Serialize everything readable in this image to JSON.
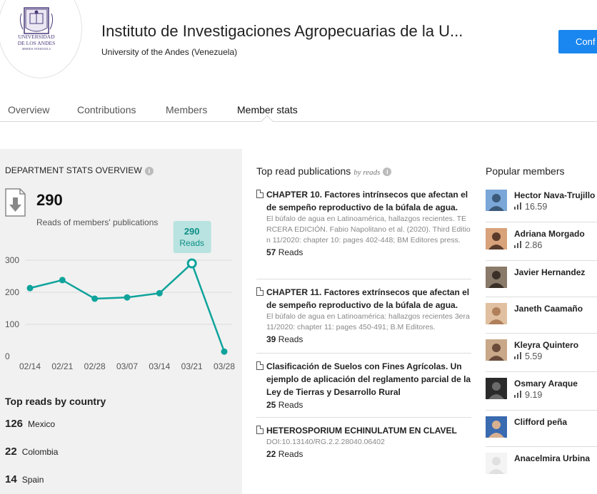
{
  "header": {
    "title": "Instituto de Investigaciones Agropecuarias de la U...",
    "subtitle": "University of the Andes (Venezuela)",
    "follow_label": "Conf",
    "logo_text_line1": "UNIVERSIDAD",
    "logo_text_line2": "DE LOS ANDES",
    "logo_text_line3": "MERIDA VENEZUELA"
  },
  "tabs": [
    "Overview",
    "Contributions",
    "Members",
    "Member stats"
  ],
  "stats": {
    "heading": "DEPARTMENT STATS OVERVIEW",
    "total": "290",
    "total_label": "Reads of members' publications",
    "tooltip_value": "290",
    "tooltip_label": "Reads"
  },
  "chart_data": {
    "type": "line",
    "x": [
      "02/14",
      "02/21",
      "02/28",
      "03/07",
      "03/14",
      "03/21",
      "03/28"
    ],
    "series": [
      {
        "values": [
          213,
          238,
          180,
          184,
          197,
          290,
          15
        ]
      }
    ],
    "yticks": [
      0,
      100,
      200,
      300
    ],
    "ylim": [
      0,
      300
    ],
    "color": "#0fa39b",
    "grid": true,
    "highlight_index": 5
  },
  "countries": {
    "heading": "Top reads by country",
    "items": [
      {
        "count": "126",
        "name": "Mexico"
      },
      {
        "count": "22",
        "name": "Colombia"
      },
      {
        "count": "14",
        "name": "Spain"
      }
    ]
  },
  "publications": {
    "heading": "Top read publications",
    "heading_sub": "by reads",
    "items": [
      {
        "title": "CHAPTER 10. Factores intrínsecos que afectan el de sempeño reproductivo de la búfala de agua.",
        "meta": "El búfalo de agua en Latinoamérica, hallazgos recientes. TERCERA EDICIÓN. Fabio Napolitano et al. (2020). Third Edition 11/2020: chapter 10: pages 402-448; BM Editores press.",
        "reads": "57",
        "reads_label": "Reads"
      },
      {
        "title": "CHAPTER 11. Factores extrínsecos que afectan el de sempeño reproductivo de la búfala de agua.",
        "meta": "El búfalo de agua en Latinoamérica: hallazgos recientes 3era 11/2020: chapter 11: pages 450-491; B.M Editores.",
        "reads": "39",
        "reads_label": "Reads"
      },
      {
        "title": "Clasificación de Suelos con Fines Agrícolas. Un ejemplo de aplicación del reglamento parcial de la Ley de Tierras y Desarrollo Rural",
        "meta": "",
        "reads": "25",
        "reads_label": "Reads"
      },
      {
        "title": "HETEROSPORIUM ECHINULATUM EN CLAVEL",
        "meta": "DOI:10.13140/RG.2.2.28040.06402",
        "reads": "22",
        "reads_label": "Reads"
      }
    ]
  },
  "members": {
    "heading": "Popular members",
    "items": [
      {
        "name": "Hector Nava-Trujillo",
        "score": "16.59"
      },
      {
        "name": "Adriana Morgado",
        "score": "2.86"
      },
      {
        "name": "Javier Hernandez",
        "score": ""
      },
      {
        "name": "Janeth Caamaño",
        "score": ""
      },
      {
        "name": "Kleyra Quintero",
        "score": "5.59"
      },
      {
        "name": "Osmary Araque",
        "score": "9.19"
      },
      {
        "name": "Clifford peña",
        "score": ""
      },
      {
        "name": "Anacelmira Urbina",
        "score": ""
      }
    ]
  }
}
